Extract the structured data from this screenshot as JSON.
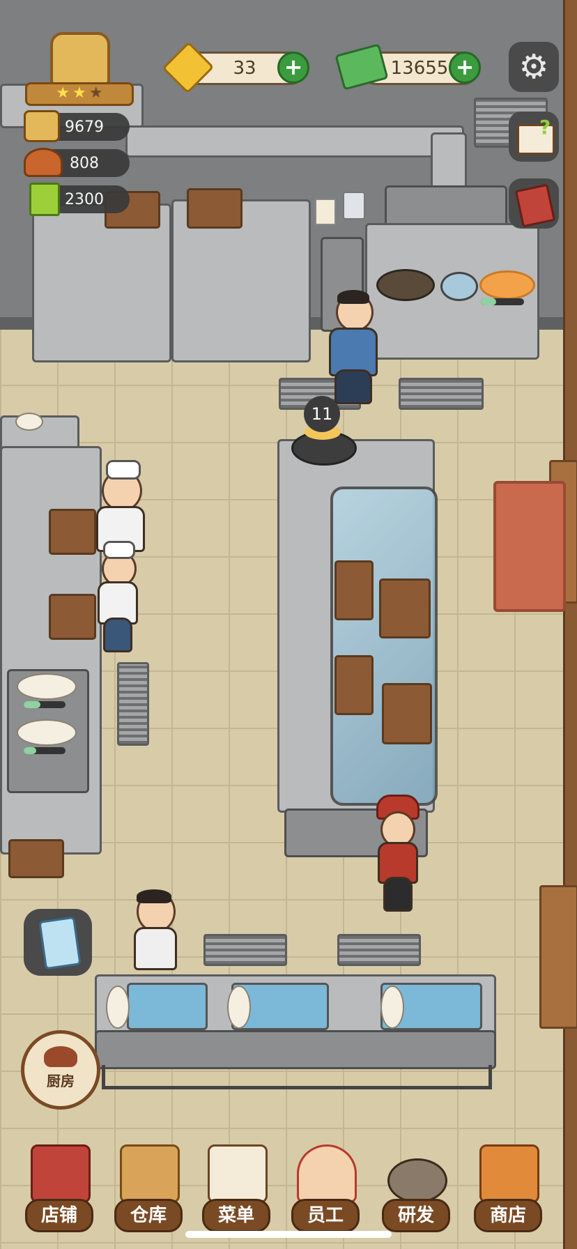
{
  "hud": {
    "gems": "33",
    "cash": "13655",
    "stats": [
      {
        "icon": "rice-pot-icon",
        "value": "9679"
      },
      {
        "icon": "serving-dish-icon",
        "value": "808"
      },
      {
        "icon": "recipe-book-icon",
        "value": "2300"
      }
    ],
    "rank_stars": 2,
    "rank_stars_max": 3
  },
  "order_bubble": "11",
  "kitchen_button": "厨房",
  "nav": [
    {
      "label": "店铺",
      "icon": "shop-building-icon"
    },
    {
      "label": "仓库",
      "icon": "warehouse-boxes-icon"
    },
    {
      "label": "菜单",
      "icon": "menu-clipboard-icon"
    },
    {
      "label": "员工",
      "icon": "staff-icon"
    },
    {
      "label": "研发",
      "icon": "research-wok-icon"
    },
    {
      "label": "商店",
      "icon": "store-icon"
    }
  ],
  "progress": {
    "stove_dish": 0.35,
    "prep_1": 0.4,
    "prep_2": 0.3
  },
  "colors": {
    "accent_green": "#3d9b3f",
    "nav_brown": "#7a4a24",
    "hud_bg": "#f3e7cf"
  }
}
